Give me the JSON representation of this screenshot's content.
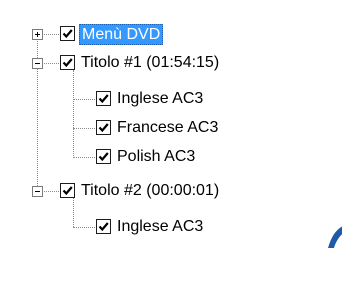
{
  "tree": {
    "nodes": [
      {
        "label": "Menù DVD",
        "checked": true,
        "expander": "plus",
        "selected": true,
        "level": 0
      },
      {
        "label": "Titolo #1 (01:54:15)",
        "checked": true,
        "expander": "minus",
        "selected": false,
        "level": 0
      },
      {
        "label": "Inglese AC3",
        "checked": true,
        "level": 1
      },
      {
        "label": "Francese AC3",
        "checked": true,
        "level": 1
      },
      {
        "label": "Polish AC3",
        "checked": true,
        "level": 1
      },
      {
        "label": "Titolo #2 (00:00:01)",
        "checked": true,
        "expander": "minus",
        "selected": false,
        "level": 0
      },
      {
        "label": "Inglese AC3",
        "checked": true,
        "level": 1
      }
    ]
  },
  "colors": {
    "selection": "#3399ff",
    "partial_logo": "#1e5aa8"
  },
  "partial_logo_icon": "logo-fragment-icon"
}
